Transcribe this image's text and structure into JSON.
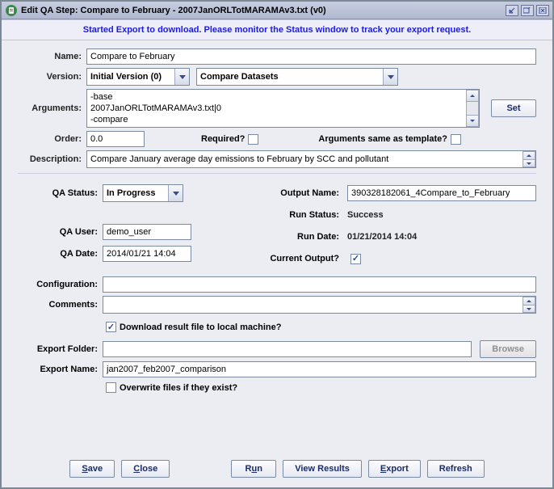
{
  "window": {
    "title": "Edit QA Step: Compare to February - 2007JanORLTotMARAMAv3.txt (v0)"
  },
  "banner": "Started Export to download. Please monitor the Status window to track your export request.",
  "labels": {
    "name": "Name:",
    "version": "Version:",
    "arguments": "Arguments:",
    "order": "Order:",
    "required": "Required?",
    "args_same": "Arguments same as template?",
    "description": "Description:",
    "qa_status": "QA Status:",
    "qa_user": "QA User:",
    "qa_date": "QA Date:",
    "output_name": "Output Name:",
    "run_status": "Run Status:",
    "run_date": "Run Date:",
    "current_output": "Current Output?",
    "configuration": "Configuration:",
    "comments": "Comments:",
    "download": "Download result file to local machine?",
    "export_folder": "Export Folder:",
    "export_name": "Export Name:",
    "overwrite": "Overwrite files if they exist?"
  },
  "fields": {
    "name": "Compare to February",
    "version_select": "Initial Version (0)",
    "program_select": "Compare Datasets",
    "arguments": "-base\n2007JanORLTotMARAMAv3.txt|0\n-compare",
    "set_btn": "Set",
    "order": "0.0",
    "required": false,
    "args_same": false,
    "description": "Compare January average day emissions to February by SCC and pollutant",
    "qa_status": "In Progress",
    "qa_user": "demo_user",
    "qa_date": "2014/01/21 14:04",
    "output_name": "390328182061_4Compare_to_February",
    "run_status": "Success",
    "run_date": "01/21/2014 14:04",
    "current_output": true,
    "configuration": "",
    "comments": "",
    "download": true,
    "export_folder": "",
    "browse_btn": "Browse",
    "export_name": "jan2007_feb2007_comparison",
    "overwrite": false
  },
  "buttons": {
    "save": "Save",
    "close": "Close",
    "run": "Run",
    "view_results": "View Results",
    "export": "Export",
    "refresh": "Refresh"
  }
}
